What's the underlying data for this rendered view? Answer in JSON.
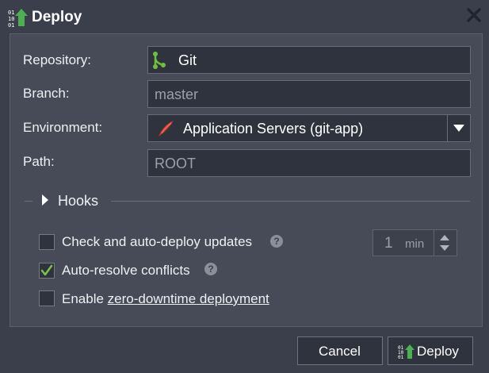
{
  "dialog": {
    "title": "Deploy",
    "close_icon": "close-icon"
  },
  "form": {
    "repository_label": "Repository:",
    "repository_value": "Git",
    "branch_label": "Branch:",
    "branch_value": "master",
    "environment_label": "Environment:",
    "environment_value": "Application Servers (git-app)",
    "path_label": "Path:",
    "path_value": "ROOT"
  },
  "hooks": {
    "label": "Hooks"
  },
  "options": {
    "auto_deploy_label": "Check and auto-deploy updates",
    "auto_deploy_checked": false,
    "interval_value": "1",
    "interval_unit": "min",
    "auto_resolve_label": "Auto-resolve conflicts",
    "auto_resolve_checked": true,
    "zero_downtime_prefix": "Enable ",
    "zero_downtime_link": "zero-downtime deployment",
    "zero_downtime_checked": false,
    "help_glyph": "?"
  },
  "footer": {
    "cancel_label": "Cancel",
    "deploy_label": "Deploy"
  },
  "colors": {
    "background": "#3a3f4b",
    "panel": "#464b57",
    "field": "#2f333d",
    "accent_green": "#4caf50",
    "git_green": "#6fbf3f",
    "check_green": "#7cc34a",
    "env_icon_red": "#c0392b"
  }
}
